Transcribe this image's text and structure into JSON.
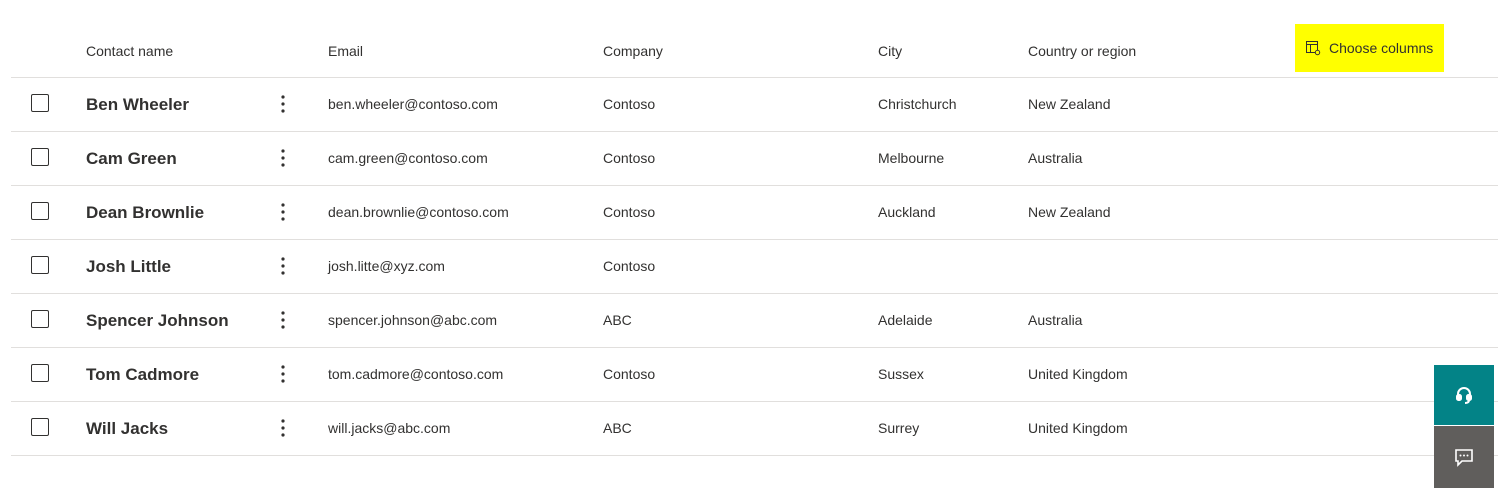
{
  "table": {
    "columns": {
      "name": "Contact name",
      "email": "Email",
      "company": "Company",
      "city": "City",
      "country": "Country or region"
    },
    "choose_columns_label": "Choose columns",
    "rows": [
      {
        "name": "Ben Wheeler",
        "email": "ben.wheeler@contoso.com",
        "company": "Contoso",
        "city": "Christchurch",
        "country": "New Zealand"
      },
      {
        "name": "Cam Green",
        "email": "cam.green@contoso.com",
        "company": "Contoso",
        "city": "Melbourne",
        "country": "Australia"
      },
      {
        "name": "Dean Brownlie",
        "email": "dean.brownlie@contoso.com",
        "company": "Contoso",
        "city": "Auckland",
        "country": "New Zealand"
      },
      {
        "name": "Josh Little",
        "email": "josh.litte@xyz.com",
        "company": "Contoso",
        "city": "",
        "country": ""
      },
      {
        "name": "Spencer Johnson",
        "email": "spencer.johnson@abc.com",
        "company": "ABC",
        "city": "Adelaide",
        "country": "Australia"
      },
      {
        "name": "Tom Cadmore",
        "email": "tom.cadmore@contoso.com",
        "company": "Contoso",
        "city": "Sussex",
        "country": "United Kingdom"
      },
      {
        "name": "Will Jacks",
        "email": "will.jacks@abc.com",
        "company": "ABC",
        "city": "Surrey",
        "country": "United Kingdom"
      }
    ]
  },
  "icons": {
    "choose_columns": "column-options-icon",
    "row_more": "more-vertical-icon",
    "support": "headset-icon",
    "feedback": "feedback-icon"
  },
  "colors": {
    "highlight": "#ffff00",
    "support_button": "#038387",
    "feedback_button": "#605e5c",
    "divider": "#e1dfdd",
    "text": "#323130"
  }
}
